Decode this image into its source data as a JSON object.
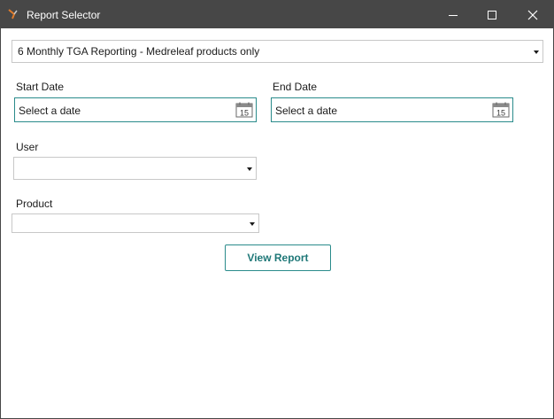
{
  "window": {
    "title": "Report Selector",
    "controls": [
      "minimize",
      "maximize",
      "close"
    ]
  },
  "report": {
    "selected": "6 Monthly TGA Reporting - Medreleaf products only"
  },
  "start_date": {
    "label": "Start Date",
    "placeholder": "Select a date",
    "calendar_day": "15"
  },
  "end_date": {
    "label": "End Date",
    "placeholder": "Select a date",
    "calendar_day": "15"
  },
  "user": {
    "label": "User",
    "selected": ""
  },
  "product": {
    "label": "Product",
    "selected": ""
  },
  "actions": {
    "view_report": "View Report"
  },
  "colors": {
    "titlebar": "#474747",
    "accent": "#2a8b8b",
    "button_text": "#1f7878",
    "app_icon": "#e07b2a"
  }
}
